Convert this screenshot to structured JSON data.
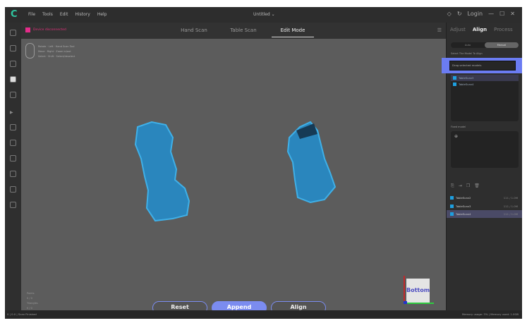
{
  "titlebar": {
    "menu": [
      "File",
      "Tools",
      "Edit",
      "History",
      "Help"
    ],
    "document": "Untitled",
    "login": "Login"
  },
  "toolbar": {
    "device": "Device disconnected",
    "tabs": [
      "Hand Scan",
      "Table Scan",
      "Edit Mode"
    ],
    "active_tab": "Edit Mode"
  },
  "hints": {
    "rows": [
      [
        "Rotate",
        "Left",
        "Hand Scan Tool"
      ],
      [
        "Move",
        "Right",
        "Zoom in/out"
      ],
      [
        "Select",
        "Shift",
        "Select/deselect"
      ]
    ]
  },
  "viewport": {
    "stats": [
      "Points",
      "0 / 0",
      "Triangles",
      "0 / 0"
    ],
    "cube_face": "Bottom",
    "axes": {
      "x": "#2ecc40",
      "y": "#c0282c",
      "z": "#2233cc"
    }
  },
  "actions": {
    "reset": "Reset",
    "append": "Append",
    "align": "Align"
  },
  "right_panel": {
    "tabs": [
      "Adjust",
      "Align",
      "Process"
    ],
    "active_tab": "Align",
    "mode_options": [
      "Auto",
      "Manual"
    ],
    "active_mode": "Manual",
    "select_label": "Select The Model To Align",
    "select_placeholder": "Drag selected models",
    "models": [
      "TableScan3",
      "TableScan4"
    ],
    "fixed_label": "Fixed model",
    "scans": [
      {
        "name": "TableScan2",
        "info": "111 / 1.0M"
      },
      {
        "name": "TableScan3",
        "info": "111 / 1.0M"
      },
      {
        "name": "TableScan4",
        "info": "111 / 1.0M",
        "selected": true
      }
    ]
  },
  "statusbar": {
    "left": "0 | 0.0 | Scan Finished",
    "right": "Memory usage: 3% | Memory used: 1.0GB"
  },
  "colors": {
    "accent": "#7b8cf0",
    "scan": "#1e9fe0",
    "device": "#e52c8a"
  }
}
